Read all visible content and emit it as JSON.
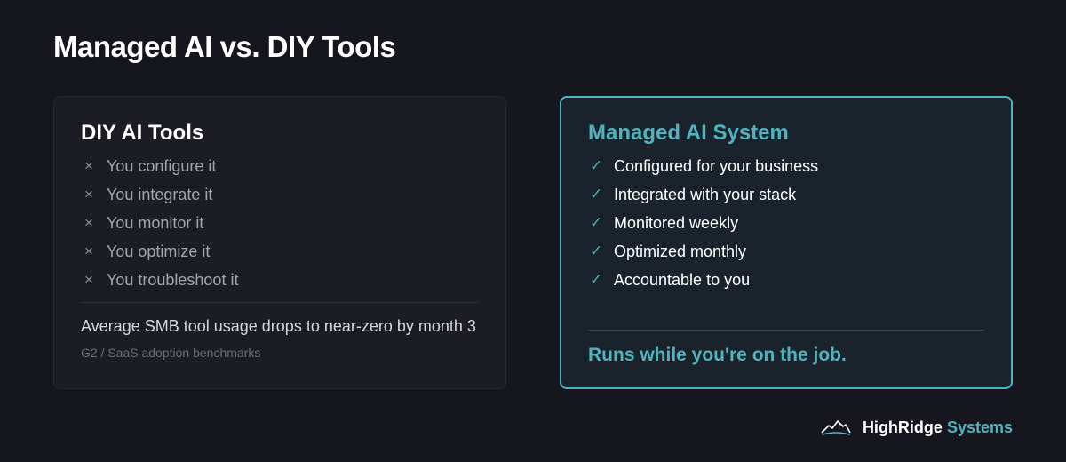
{
  "page": {
    "title": "Managed AI vs. DIY Tools"
  },
  "diy": {
    "title": "DIY AI Tools",
    "items": [
      "You configure it",
      "You integrate it",
      "You monitor it",
      "You optimize it",
      "You troubleshoot it"
    ],
    "stat": "Average SMB tool usage drops to near-zero by month 3",
    "source": "G2 / SaaS adoption benchmarks"
  },
  "managed": {
    "title": "Managed AI System",
    "items": [
      "Configured for your business",
      "Integrated with your stack",
      "Monitored weekly",
      "Optimized monthly",
      "Accountable to you"
    ],
    "tagline": "Runs while you're on the job."
  },
  "brand": {
    "name_primary": "HighRidge",
    "name_accent": "Systems",
    "logo_icon": "mountain-logo-icon"
  },
  "icons": {
    "cross": "×",
    "check": "✓"
  },
  "colors": {
    "background": "#16161f",
    "accent": "#4fb4bd",
    "card_diy": "#1b1c24",
    "card_managed": "#1a232c"
  }
}
